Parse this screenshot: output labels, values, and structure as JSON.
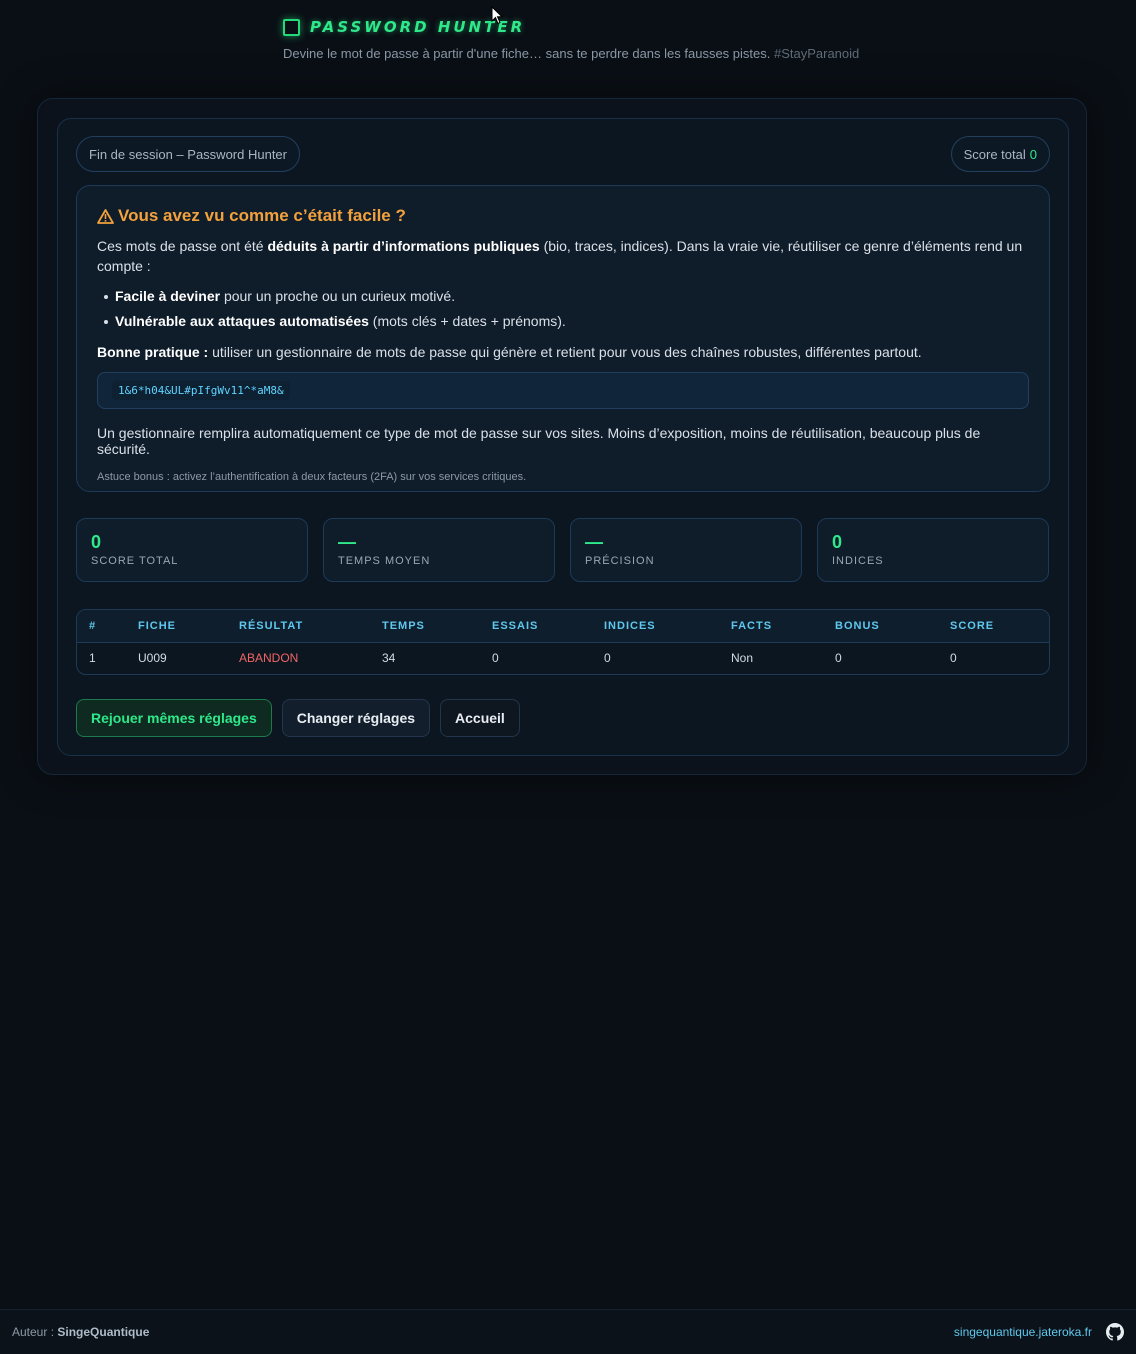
{
  "header": {
    "title": "PASSWORD HUNTER",
    "tagline": "Devine le mot de passe à partir d'une fiche… sans te perdre dans les fausses pistes.",
    "hashtag": "#StayParanoid"
  },
  "session": {
    "label": "Fin de session – Password Hunter",
    "score_label": "Score total",
    "score_value": "0"
  },
  "warning": {
    "title": "Vous avez vu comme c’était facile ?",
    "intro_start": "Ces mots de passe ont été ",
    "intro_bold": "déduits à partir d’informations publiques",
    "intro_end": " (bio, traces, indices). Dans la vraie vie, réutiliser ce genre d’éléments rend un compte :",
    "bullets": [
      {
        "bold": "Facile à deviner",
        "rest": " pour un proche ou un curieux motivé."
      },
      {
        "bold": "Vulnérable aux attaques automatisées",
        "rest": " (mots clés + dates + prénoms)."
      }
    ],
    "practice_bold": "Bonne pratique :",
    "practice_rest": " utiliser un gestionnaire de mots de passe qui génère et retient pour vous des chaînes robustes, différentes partout.",
    "example_password": "1&6*h04&UL#pIfgWv11^*aM8&",
    "manager_text": "Un gestionnaire remplira automatiquement ce type de mot de passe sur vos sites. Moins d’exposition, moins de réutilisation, beaucoup plus de sécurité.",
    "bonus_tip": "Astuce bonus : activez l’authentification à deux facteurs (2FA) sur vos services critiques."
  },
  "stats": [
    {
      "value": "0",
      "label": "SCORE TOTAL"
    },
    {
      "value": "—",
      "label": "TEMPS MOYEN"
    },
    {
      "value": "—",
      "label": "PRÉCISION"
    },
    {
      "value": "0",
      "label": "INDICES"
    }
  ],
  "table": {
    "headers": [
      "#",
      "FICHE",
      "RÉSULTAT",
      "TEMPS",
      "ESSAIS",
      "INDICES",
      "FACTS",
      "BONUS",
      "SCORE"
    ],
    "rows": [
      [
        "1",
        "U009",
        "ABANDON",
        "34",
        "0",
        "0",
        "Non",
        "0",
        "0"
      ]
    ]
  },
  "actions": {
    "replay": "Rejouer mêmes réglages",
    "change": "Changer réglages",
    "home": "Accueil"
  },
  "footer": {
    "author_label": "Auteur :",
    "author_name": "SingeQuantique",
    "site": "singequantique.jateroka.fr"
  },
  "colors": {
    "accent": "#2ee88a",
    "warning": "#f2a13d",
    "danger": "#f06565",
    "link": "#5fc8ee"
  }
}
